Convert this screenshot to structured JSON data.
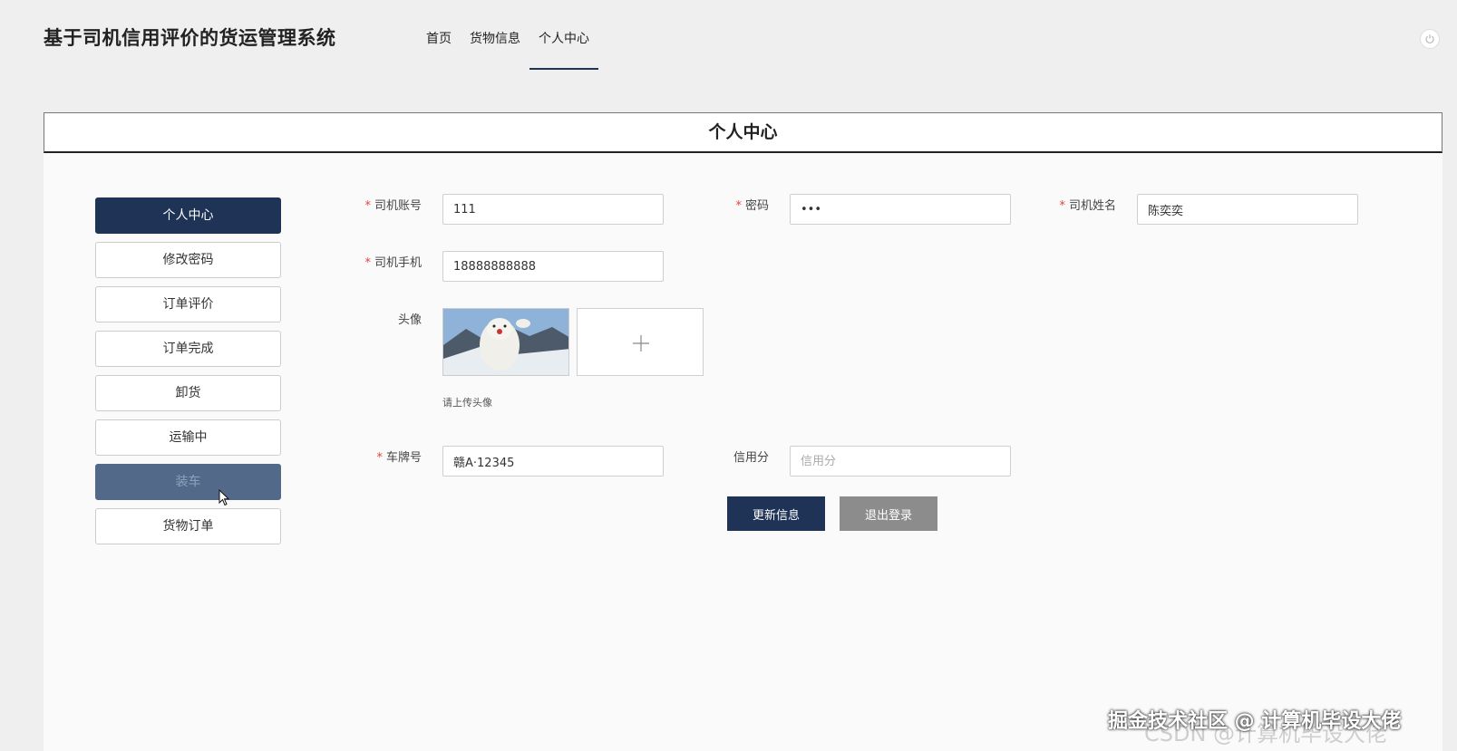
{
  "header": {
    "app_title": "基于司机信用评价的货运管理系统",
    "nav": [
      {
        "label": "首页",
        "active": false
      },
      {
        "label": "货物信息",
        "active": false
      },
      {
        "label": "个人中心",
        "active": true
      }
    ],
    "power_icon": "power-icon"
  },
  "panel": {
    "title": "个人中心"
  },
  "side_menu": [
    {
      "label": "个人中心",
      "state": "active"
    },
    {
      "label": "修改密码",
      "state": "normal"
    },
    {
      "label": "订单评价",
      "state": "normal"
    },
    {
      "label": "订单完成",
      "state": "normal"
    },
    {
      "label": "卸货",
      "state": "normal"
    },
    {
      "label": "运输中",
      "state": "normal"
    },
    {
      "label": "装车",
      "state": "hover"
    },
    {
      "label": "货物订单",
      "state": "normal"
    }
  ],
  "form": {
    "account": {
      "label": "司机账号",
      "value": "111",
      "required": true
    },
    "password": {
      "label": "密码",
      "value": "•••",
      "required": true
    },
    "driver_name": {
      "label": "司机姓名",
      "value": "陈奕奕",
      "required": true
    },
    "phone": {
      "label": "司机手机",
      "value": "18888888888",
      "required": true
    },
    "avatar": {
      "label": "头像",
      "hint": "请上传头像",
      "upload_icon": "plus-icon"
    },
    "plate": {
      "label": "车牌号",
      "value": "赣A·12345",
      "required": true
    },
    "credit": {
      "label": "信用分",
      "value": "",
      "placeholder": "信用分",
      "required": false
    }
  },
  "buttons": {
    "update": "更新信息",
    "logout": "退出登录"
  },
  "watermark": {
    "main": "掘金技术社区 @ 计算机毕设大佬",
    "ghost": "CSDN @计算机毕设大佬"
  },
  "colors": {
    "primary": "#1e3356",
    "hover": "#52698a",
    "required": "#e2453c",
    "gray_button": "#8c8c8c"
  }
}
